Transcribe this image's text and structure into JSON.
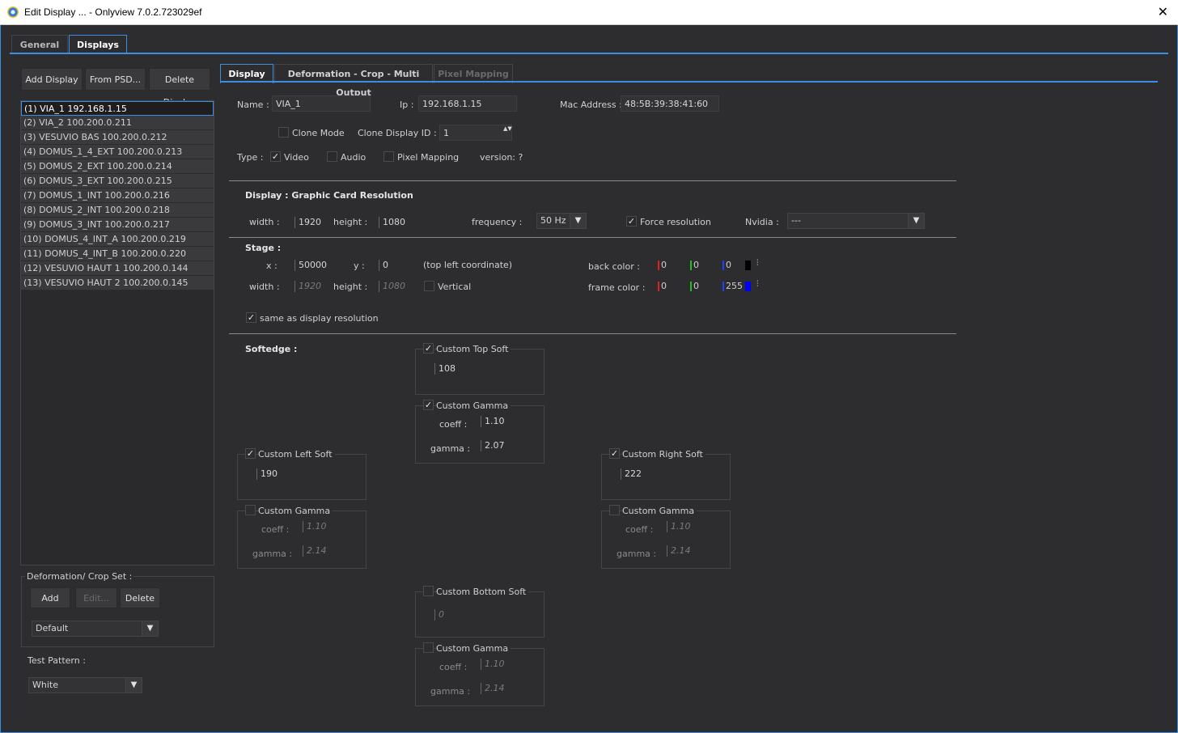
{
  "window": {
    "title": "Edit Display ... - Onlyview  7.0.2.723029ef",
    "close": "✕"
  },
  "tabs": [
    "General",
    "Displays"
  ],
  "left": {
    "buttons": {
      "add": "Add Display",
      "psd": "From PSD...",
      "delete": "Delete Display"
    },
    "displays": [
      "(1)  VIA_1  192.168.1.15",
      "(2)  VIA_2  100.200.0.211",
      "(3)  VESUVIO BAS  100.200.0.212",
      "(4)  DOMUS_1_4_EXT  100.200.0.213",
      "(5)  DOMUS_2_EXT  100.200.0.214",
      "(6)  DOMUS_3_EXT  100.200.0.215",
      "(7)  DOMUS_1_INT  100.200.0.216",
      "(8)  DOMUS_2_INT  100.200.0.218",
      "(9)  DOMUS_3_INT  100.200.0.217",
      "(10)  DOMUS_4_INT_A  100.200.0.219",
      "(11)  DOMUS_4_INT_B  100.200.0.220",
      "(12)  VESUVIO HAUT 1  100.200.0.144",
      "(13)  VESUVIO HAUT 2  100.200.0.145"
    ],
    "deform_title": "Deformation/ Crop  Set :",
    "deform_buttons": {
      "add": "Add",
      "edit": "Edit...",
      "delete": "Delete"
    },
    "deform_value": "Default",
    "test_pattern_label": "Test Pattern :",
    "test_pattern_value": "White"
  },
  "subtabs": [
    "Display",
    "Deformation - Crop - Multi Output",
    "Pixel Mapping"
  ],
  "display": {
    "name_label": "Name :",
    "name": "VIA_1",
    "ip_label": "Ip :",
    "ip": "192.168.1.15",
    "mac_label": "Mac Address :",
    "mac": "48:5B:39:38:41:60",
    "clone_mode": "Clone Mode",
    "clone_id_label": "Clone Display ID :",
    "clone_id": "1",
    "type_label": "Type :",
    "video": "Video",
    "audio": "Audio",
    "pixel_mapping": "Pixel Mapping",
    "version": "version: ?"
  },
  "gcr": {
    "title": "Display : Graphic Card Resolution",
    "width_label": "width :",
    "width": "1920",
    "height_label": "height :",
    "height": "1080",
    "freq_label": "frequency :",
    "freq": "50 Hz",
    "force": "Force resolution",
    "nvidia_label": "Nvidia :",
    "nvidia": "---"
  },
  "stage": {
    "title": "Stage :",
    "x_label": "x :",
    "x": "50000",
    "y_label": "y :",
    "y": "0",
    "coord_note": "(top left coordinate)",
    "width_label": "width :",
    "width": "1920",
    "height_label": "height :",
    "height": "1080",
    "vertical": "Vertical",
    "back_label": "back color :",
    "back": [
      "0",
      "0",
      "0"
    ],
    "frame_label": "frame color :",
    "frame": [
      "0",
      "0",
      "255"
    ],
    "same": "same as display resolution"
  },
  "soft": {
    "title": "Softedge :",
    "top": {
      "label": "Custom Top Soft",
      "value": "108",
      "gamma": "Custom Gamma",
      "coeff_label": "coeff :",
      "coeff": "1.10",
      "gamma_label": "gamma :",
      "gamma_v": "2.07"
    },
    "left": {
      "label": "Custom Left Soft",
      "value": "190",
      "gamma": "Custom Gamma",
      "coeff_label": "coeff :",
      "coeff": "1.10",
      "gamma_label": "gamma :",
      "gamma_v": "2.14"
    },
    "right": {
      "label": "Custom Right Soft",
      "value": "222",
      "gamma": "Custom Gamma",
      "coeff_label": "coeff :",
      "coeff": "1.10",
      "gamma_label": "gamma :",
      "gamma_v": "2.14"
    },
    "bottom": {
      "label": "Custom Bottom Soft",
      "value": "0",
      "gamma": "Custom Gamma",
      "coeff_label": "coeff :",
      "coeff": "1.10",
      "gamma_label": "gamma :",
      "gamma_v": "2.14"
    }
  },
  "check": "✓",
  "arrow": "▼",
  "spin": "▲▼",
  "colors": {
    "accent": "#3a8ee6",
    "red": "#e02020",
    "green": "#20c020",
    "blue": "#2040ff"
  }
}
